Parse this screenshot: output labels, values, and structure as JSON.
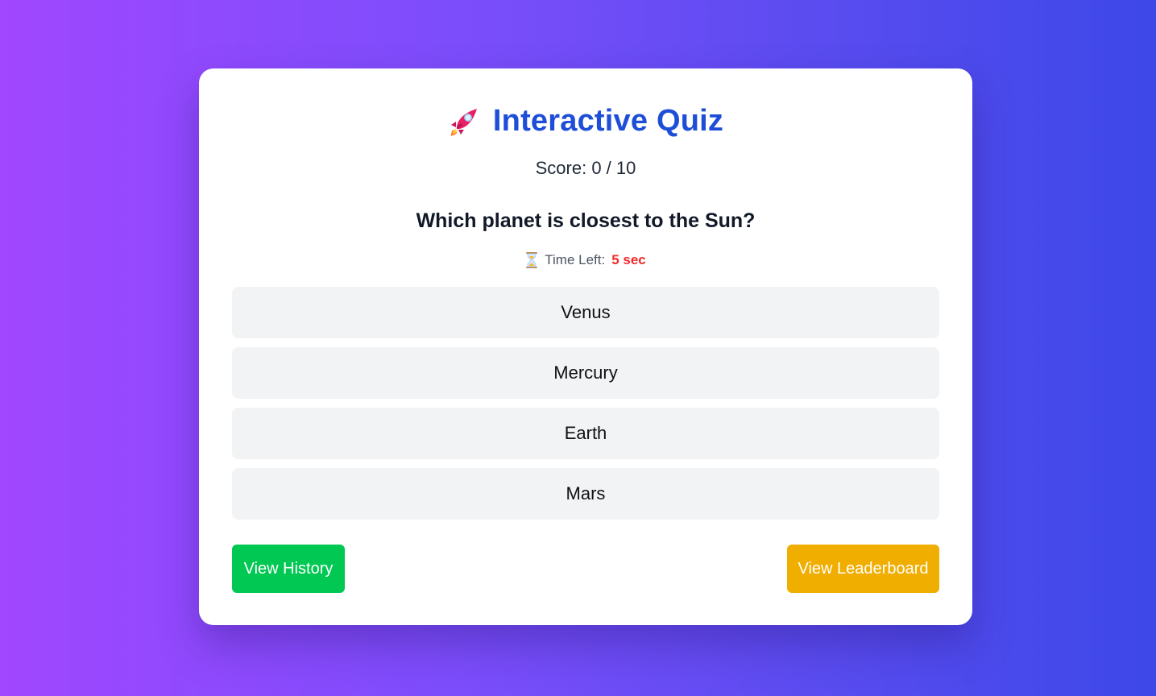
{
  "header": {
    "icon": "rocket-icon",
    "title": "Interactive Quiz",
    "title_color": "#1d4ed8"
  },
  "score": {
    "text": "Score: 0 / 10",
    "current": 0,
    "total": 10
  },
  "question": {
    "text": "Which planet is closest to the Sun?"
  },
  "timer": {
    "icon": "hourglass-icon",
    "label": "Time Left:",
    "value": "5 sec",
    "value_color": "#ef2b2b"
  },
  "options": [
    {
      "label": "Venus"
    },
    {
      "label": "Mercury"
    },
    {
      "label": "Earth"
    },
    {
      "label": "Mars"
    }
  ],
  "actions": {
    "history_label": "View History",
    "history_color": "#00c853",
    "leaderboard_label": "View Leaderboard",
    "leaderboard_color": "#f0ae00"
  },
  "theme": {
    "background_start": "#a047ff",
    "background_end": "#3d48e8",
    "card": "#ffffff",
    "option_bg": "#f2f3f5"
  }
}
